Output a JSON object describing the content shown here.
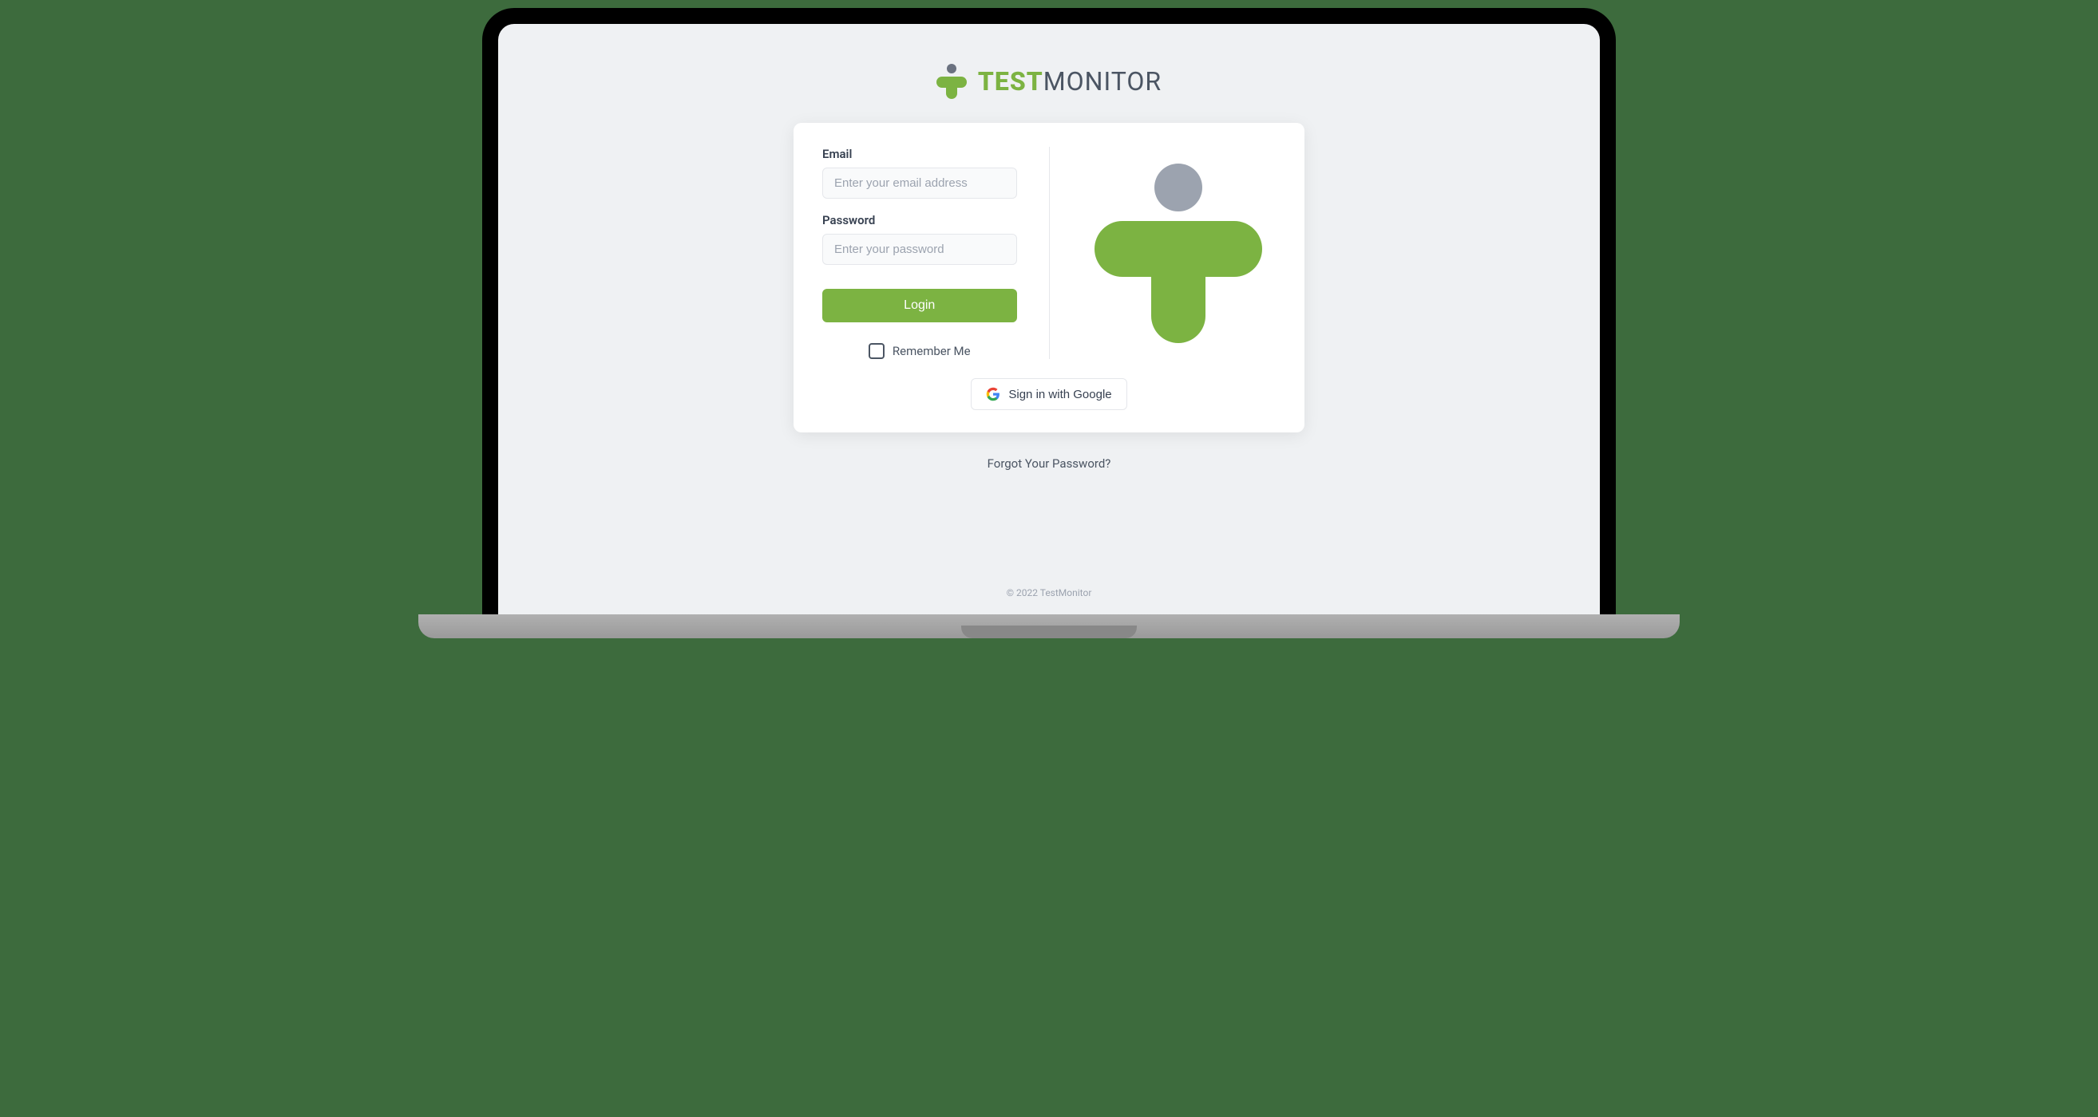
{
  "brand": {
    "name_bold": "TEST",
    "name_light": "MONITOR"
  },
  "form": {
    "email_label": "Email",
    "email_placeholder": "Enter your email address",
    "password_label": "Password",
    "password_placeholder": "Enter your password",
    "login_button": "Login",
    "remember_label": "Remember Me",
    "google_button": "Sign in with Google"
  },
  "links": {
    "forgot_password": "Forgot Your Password?"
  },
  "footer": {
    "copyright": "© 2022 TestMonitor"
  },
  "colors": {
    "accent": "#7cb342",
    "gray": "#9ca3af"
  }
}
